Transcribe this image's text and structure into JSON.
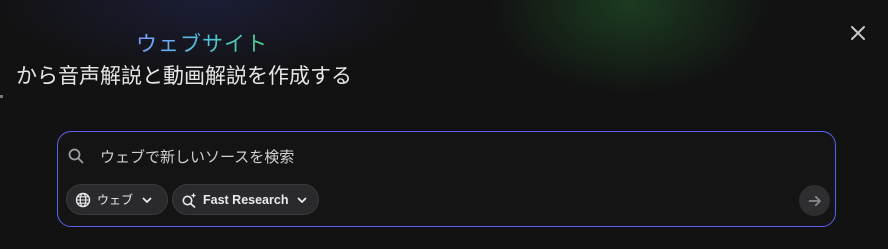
{
  "header": {
    "title_highlight": "ウェブサイト",
    "title_main": "から音声解説と動画解説を作成する"
  },
  "search": {
    "placeholder": "ウェブで新しいソースを検索",
    "source_chip_label": "ウェブ",
    "mode_chip_label": "Fast Research"
  },
  "icons": {
    "close": "close-icon",
    "search": "search-icon",
    "globe": "globe-icon",
    "research": "sparkle-search-icon",
    "chevron": "chevron-down-icon",
    "submit": "arrow-right-icon"
  },
  "colors": {
    "border_accent": "#5a62f0",
    "title_gradient_start": "#7b9cff",
    "title_gradient_end": "#52d08a"
  }
}
